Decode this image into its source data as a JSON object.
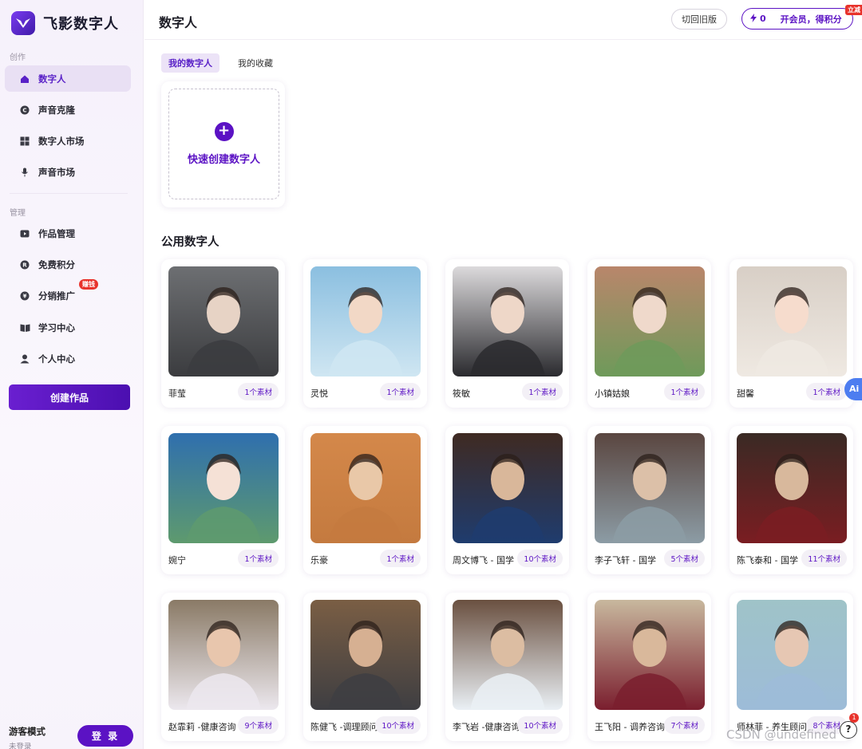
{
  "app": {
    "name": "飞影数字人"
  },
  "sidebar": {
    "section_create": "创作",
    "section_manage": "管理",
    "create_items": [
      {
        "label": "数字人",
        "icon": "home-icon"
      },
      {
        "label": "声音克隆",
        "icon": "copyright-icon"
      },
      {
        "label": "数字人市场",
        "icon": "grid-icon"
      },
      {
        "label": "声音市场",
        "icon": "microphone-icon"
      }
    ],
    "manage_items": [
      {
        "label": "作品管理",
        "icon": "play-icon"
      },
      {
        "label": "免费积分",
        "icon": "registered-icon"
      },
      {
        "label": "分销推广",
        "icon": "yen-icon",
        "badge": "赚钱"
      },
      {
        "label": "学习中心",
        "icon": "book-icon"
      },
      {
        "label": "个人中心",
        "icon": "user-icon"
      }
    ],
    "create_button": "创建作品",
    "guest_title": "游客模式",
    "guest_sub": "未登录",
    "login_button": "登 录"
  },
  "header": {
    "title": "数字人",
    "old_version": "切回旧版",
    "points": "0",
    "vip_label": "开会员，得积分",
    "vip_tag": "立减"
  },
  "tabs": [
    "我的数字人",
    "我的收藏"
  ],
  "quick_create": "快速创建数字人",
  "public_title": "公用数字人",
  "avatars": [
    {
      "name": "菲莹",
      "count": "1个素材"
    },
    {
      "name": "灵悦",
      "count": "1个素材"
    },
    {
      "name": "筱敏",
      "count": "1个素材"
    },
    {
      "name": "小镇姑娘",
      "count": "1个素材"
    },
    {
      "name": "甜馨",
      "count": "1个素材"
    },
    {
      "name": "婉宁",
      "count": "1个素材"
    },
    {
      "name": "乐豪",
      "count": "1个素材"
    },
    {
      "name": "周文博飞 - 国学",
      "count": "10个素材"
    },
    {
      "name": "李子飞轩 - 国学",
      "count": "5个素材"
    },
    {
      "name": "陈飞泰和 - 国学",
      "count": "11个素材"
    },
    {
      "name": "赵霏莉 -健康咨询",
      "count": "9个素材"
    },
    {
      "name": "陈健飞 -调理顾问",
      "count": "10个素材"
    },
    {
      "name": "李飞岩 -健康咨询",
      "count": "10个素材"
    },
    {
      "name": "王飞阳 - 调养咨询",
      "count": "7个素材"
    },
    {
      "name": "师林菲 - 养生顾问",
      "count": "8个素材"
    }
  ],
  "float": {
    "ai": "Ai",
    "help": "?",
    "help_count": "1"
  },
  "watermark": "CSDN @undefined"
}
